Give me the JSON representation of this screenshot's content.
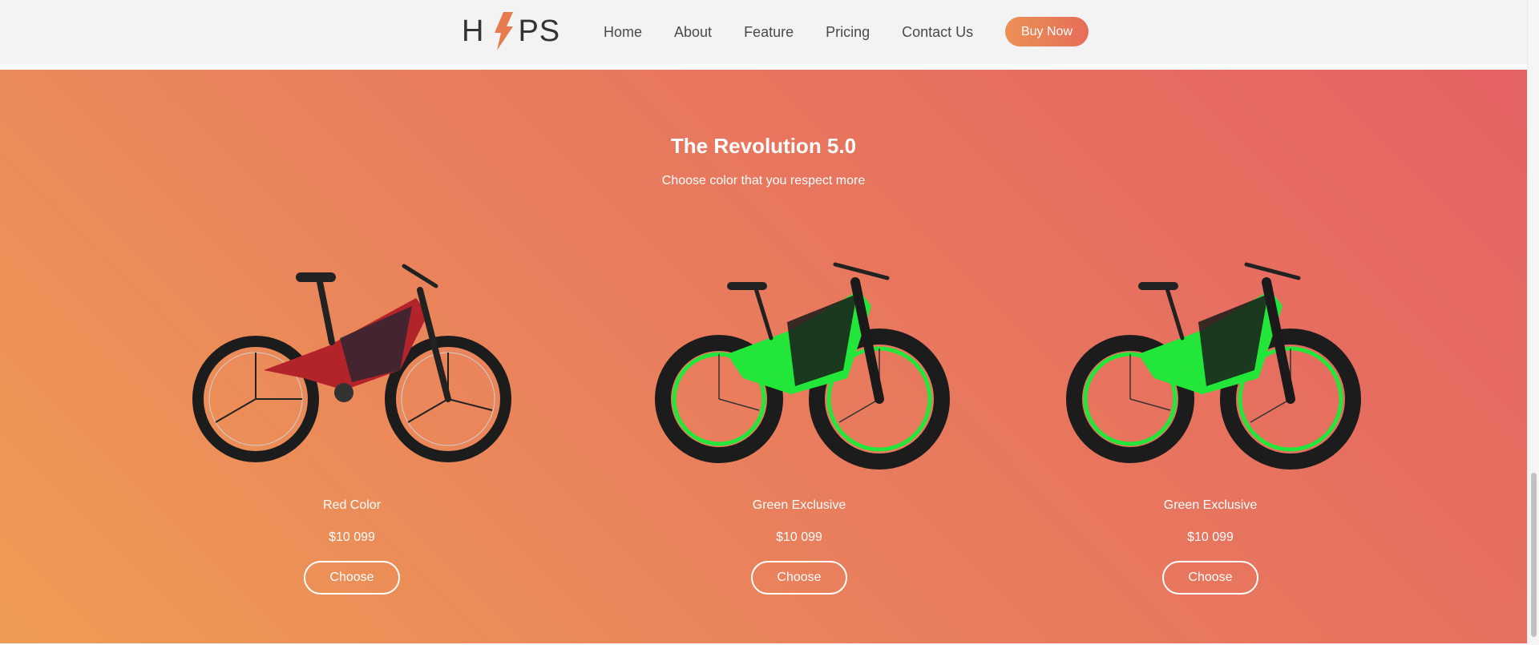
{
  "header": {
    "logo_left": "H",
    "logo_right": "PS",
    "logo_icon": "lightning-bolt-icon",
    "nav": [
      "Home",
      "About",
      "Feature",
      "Pricing",
      "Contact Us"
    ],
    "buy_label": "Buy Now"
  },
  "hero": {
    "title": "The Revolution 5.0",
    "subtitle": "Choose color that you respect more"
  },
  "products": [
    {
      "name": "Red Color",
      "price": "$10 099",
      "button": "Choose",
      "color": "#b3242a"
    },
    {
      "name": "Green Exclusive",
      "price": "$10 099",
      "button": "Choose",
      "color": "#22e63a"
    },
    {
      "name": "Green Exclusive",
      "price": "$10 099",
      "button": "Choose",
      "color": "#22e63a"
    }
  ],
  "colors": {
    "accent": "#ec9155",
    "gradient_start": "#ee9c55",
    "gradient_end": "#e46262",
    "header_bg": "#f3f3f3"
  }
}
